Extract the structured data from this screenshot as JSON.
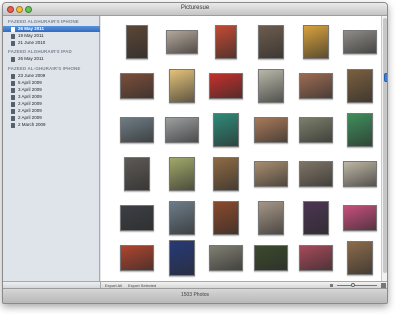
{
  "window": {
    "title": "Picturesue"
  },
  "colors": {
    "close": "#ee5a52",
    "minimize": "#f4bd3c",
    "zoom": "#62c554",
    "selection": "#3b79cc"
  },
  "sidebar": {
    "groups": [
      {
        "header": "FAZEED ALGHURAIR'S IPHONE",
        "items": [
          {
            "label": "26 May 2011",
            "selected": true
          },
          {
            "label": "19 May 2011",
            "selected": false
          },
          {
            "label": "21 June 2010",
            "selected": false
          }
        ]
      },
      {
        "header": "FAZEED ALGHURAIR'S IPAD",
        "items": [
          {
            "label": "26 May 2011",
            "selected": false
          }
        ]
      },
      {
        "header": "FAZEED AL-GHURAIR'S IPHONE",
        "items": [
          {
            "label": "23 June 2009",
            "selected": false
          },
          {
            "label": "5 April 2009",
            "selected": false
          },
          {
            "label": "3 April 2009",
            "selected": false
          },
          {
            "label": "3 April 2009",
            "selected": false
          },
          {
            "label": "2 April 2009",
            "selected": false
          },
          {
            "label": "2 April 2009",
            "selected": false
          },
          {
            "label": "2 April 2009",
            "selected": false
          },
          {
            "label": "2 March 2009",
            "selected": false
          }
        ]
      }
    ]
  },
  "photos": [
    [
      "#5a4636",
      "#b4a79a",
      "#c24a34",
      "#6d5c4e",
      "#d7a13c",
      "#8e8c88"
    ],
    [
      "#7b4e3a",
      "#e3c27a",
      "#c4302b",
      "#b7b7a9",
      "#9c6b53",
      "#7a5f3f"
    ],
    [
      "#6f7d85",
      "#9d9fa0",
      "#2f8a78",
      "#a87a5a",
      "#7b7f6a",
      "#3f8e5b"
    ],
    [
      "#5e5a55",
      "#a2a86a",
      "#8e6a44",
      "#a88d70",
      "#7f7567",
      "#bfb7a6"
    ],
    [
      "#3c3f45",
      "#6d7c88",
      "#8a4a2c",
      "#a59687",
      "#4b3552",
      "#c64f7c"
    ],
    [
      "#b0452e",
      "#263a7a",
      "#7f7f72",
      "#3b4a2c",
      "#a64a5a",
      "#8b6b4b"
    ]
  ],
  "bottombar": {
    "export_all": "Export All",
    "export_selected": "Export Selected"
  },
  "status": {
    "text": "1503 Photos"
  }
}
